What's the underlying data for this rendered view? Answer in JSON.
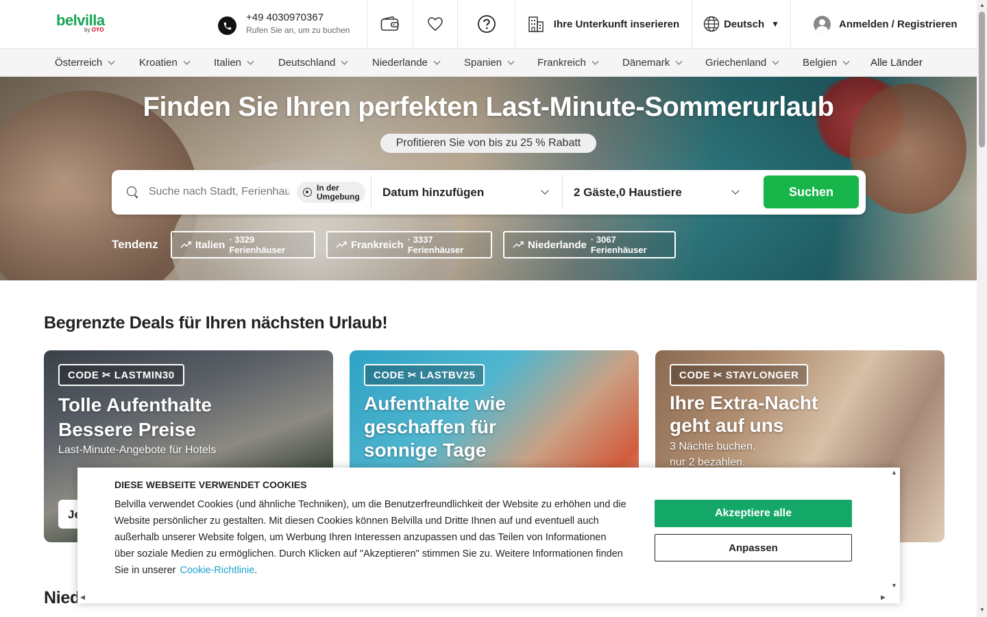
{
  "header": {
    "logo": {
      "word": "belvilla",
      "by": "by",
      "brand": "OYO"
    },
    "phone": {
      "number": "+49 4030970367",
      "subtitle": "Rufen Sie an, um zu buchen"
    },
    "wallet_icon": "wallet-icon",
    "favorites_icon": "heart-icon",
    "help_icon": "question-circle-icon",
    "list_property": "Ihre Unterkunft inserieren",
    "language": "Deutsch",
    "login": "Anmelden / Registrieren"
  },
  "nav": {
    "countries": [
      "Österreich",
      "Kroatien",
      "Italien",
      "Deutschland",
      "Niederlande",
      "Spanien",
      "Frankreich",
      "Dänemark",
      "Griechenland",
      "Belgien"
    ],
    "all_countries": "Alle Länder"
  },
  "hero": {
    "title": "Finden Sie Ihren perfekten Last-Minute-Sommerurlaub",
    "promo": "Profitieren Sie von bis zu 25 % Rabatt",
    "search": {
      "placeholder": "Suche nach Stadt, Ferienhaus",
      "nearby_line1": "In der",
      "nearby_line2": "Umgebung",
      "dates": "Datum hinzufügen",
      "guests": "2 Gäste,0 Haustiere",
      "button": "Suchen"
    },
    "trend_label": "Tendenz",
    "trends": [
      {
        "name": "Italien",
        "count": "· 3329 Ferienhäuser"
      },
      {
        "name": "Frankreich",
        "count": "· 3337 Ferienhäuser"
      },
      {
        "name": "Niederlande",
        "count": "· 3067 Ferienhäuser"
      }
    ]
  },
  "deals": {
    "title": "Begrenzte Deals für Ihren nächsten Urlaub!",
    "cards": [
      {
        "code": "CODE ✂ LASTMIN30",
        "head1": "Tolle Aufenthalte",
        "head2": "Bessere Preise",
        "sub1": "Last-Minute-Angebote für Hotels",
        "sub2": "",
        "button": "Je"
      },
      {
        "code": "CODE ✂ LASTBV25",
        "head1": "Aufenthalte wie",
        "head2": "geschaffen für",
        "head3": "sonnige Tage"
      },
      {
        "code": "CODE ✂ STAYLONGER",
        "head1": "Ihre Extra-Nacht",
        "head2": "geht auf uns",
        "sub1": "3 Nächte buchen,",
        "sub2": "nur 2 bezahlen."
      }
    ]
  },
  "section2_title": "Niederlande – Beliebte Städte für Ferienhäuser",
  "cookie": {
    "title": "DIESE WEBSEITE VERWENDET COOKIES",
    "text": "Belvilla verwendet Cookies (und ähnliche Techniken), um die Benutzerfreundlichkeit der Website zu erhöhen und die Website persönlicher zu gestalten. Mit diesen Cookies können Belvilla und Dritte Ihnen auf und eventuell auch außerhalb unserer Website folgen, um Werbung Ihren Interessen anzupassen und das Teilen von Informationen über soziale Medien zu ermöglichen. Durch Klicken auf \"Akzeptieren\" stimmen Sie zu. Weitere Informationen finden Sie in unserer",
    "link": "Cookie-Richtlinie",
    "period": ".",
    "accept": "Akzeptiere alle",
    "customize": "Anpassen"
  },
  "colors": {
    "brand_green": "#18a558",
    "search_button": "#18b54a",
    "accept_button": "#14a868",
    "link": "#1aa3d1"
  }
}
